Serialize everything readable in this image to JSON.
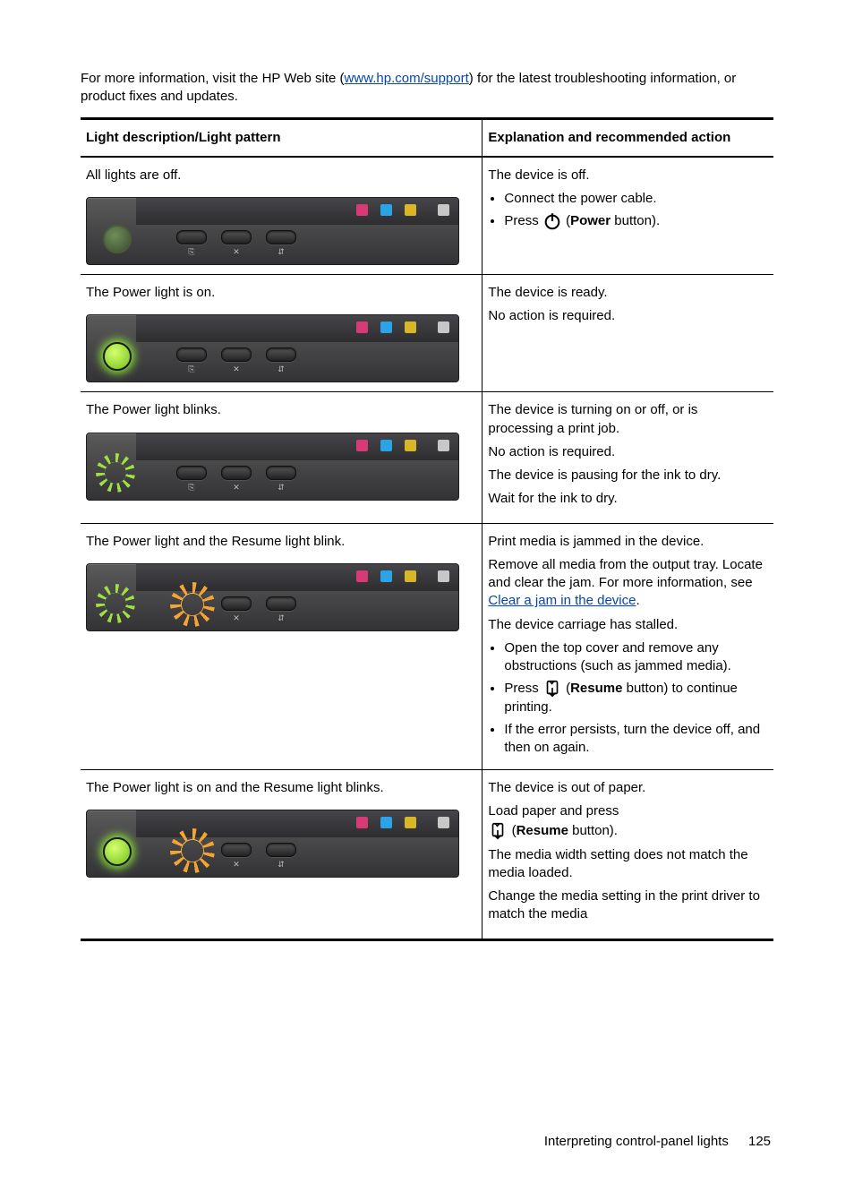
{
  "intro": {
    "prefix": "For more information, visit the HP Web site (",
    "link_text": "www.hp.com/support",
    "suffix": ") for the latest troubleshooting information, or product fixes and updates."
  },
  "table": {
    "head_left": "Light description/Light pattern",
    "head_right": "Explanation and recommended action"
  },
  "rows": {
    "r1": {
      "left": "All lights are off.",
      "right_p1": "The device is off.",
      "right_li1": "Connect the power cable.",
      "right_li2a": "Press ",
      "right_li2b": " (",
      "right_li2_bold": "Power",
      "right_li2c": " button)."
    },
    "r2": {
      "left": "The Power light is on.",
      "right_p1": "The device is ready.",
      "right_p2": "No action is required."
    },
    "r3": {
      "left": "The Power light blinks.",
      "right_p1": "The device is turning on or off, or is processing a print job.",
      "right_p2": "No action is required.",
      "right_p3": "The device is pausing for the ink to dry.",
      "right_p4": "Wait for the ink to dry."
    },
    "r4": {
      "left": "The Power light and the Resume light blink.",
      "right_p1": "Print media is jammed in the device.",
      "right_p2a": "Remove all media from the output tray. Locate and clear the jam. For more information, see ",
      "right_p2_link": "Clear a jam in the device",
      "right_p2b": ".",
      "right_p3": "The device carriage has stalled.",
      "right_li1": "Open the top cover and remove any obstructions (such as jammed media).",
      "right_li2a": "Press ",
      "right_li2b": " (",
      "right_li2_bold": "Resume",
      "right_li2c": " button) to continue printing.",
      "right_li3": "If the error persists, turn the device off, and then on again."
    },
    "r5": {
      "left": "The Power light is on and the Resume light blinks.",
      "right_p1": "The device is out of paper.",
      "right_p2a": "Load paper and press ",
      "right_p2b": " (",
      "right_p2_bold": "Resume",
      "right_p2c": " button).",
      "right_p3": "The media width setting does not match the media loaded.",
      "right_p4": "Change the media setting in the print driver to match the media"
    }
  },
  "footer": {
    "section": "Interpreting control-panel lights",
    "page": "125"
  }
}
